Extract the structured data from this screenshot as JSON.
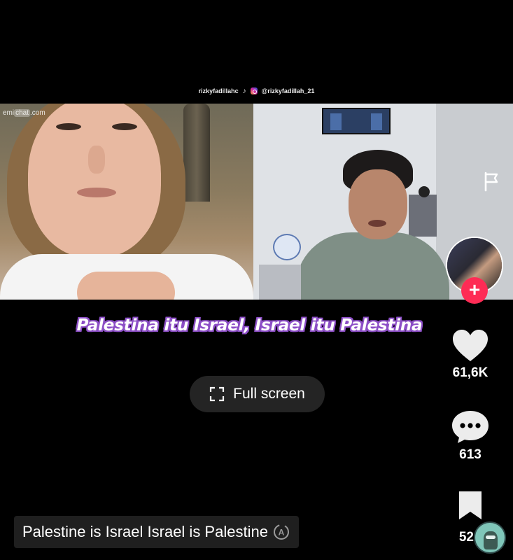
{
  "watermark": {
    "tiktok_handle": "rizkyfadillahc",
    "instagram_handle": "@rizkyfadillah_21"
  },
  "video": {
    "site_logo_prefix": "emi",
    "site_logo_box": "chat",
    "site_logo_suffix": ".com"
  },
  "caption": {
    "text": "Palestina itu Israel, Israel itu Palestina"
  },
  "fullscreen_button": {
    "label": "Full screen"
  },
  "actions": {
    "like_count": "61,6K",
    "comment_count": "613",
    "save_count": "52"
  },
  "translation": {
    "text": "Palestine is Israel Israel is Palestine"
  },
  "icons": {
    "flag": "flag-icon",
    "follow": "plus-icon",
    "like": "heart-icon",
    "comment": "comment-bubble-icon",
    "save": "bookmark-icon",
    "translate": "translate-icon",
    "fullscreen": "fullscreen-icon"
  },
  "colors": {
    "background": "#000000",
    "follow_accent": "#fe2c55",
    "caption_outline": "#8d4fc7",
    "pill_background": "#242424"
  }
}
